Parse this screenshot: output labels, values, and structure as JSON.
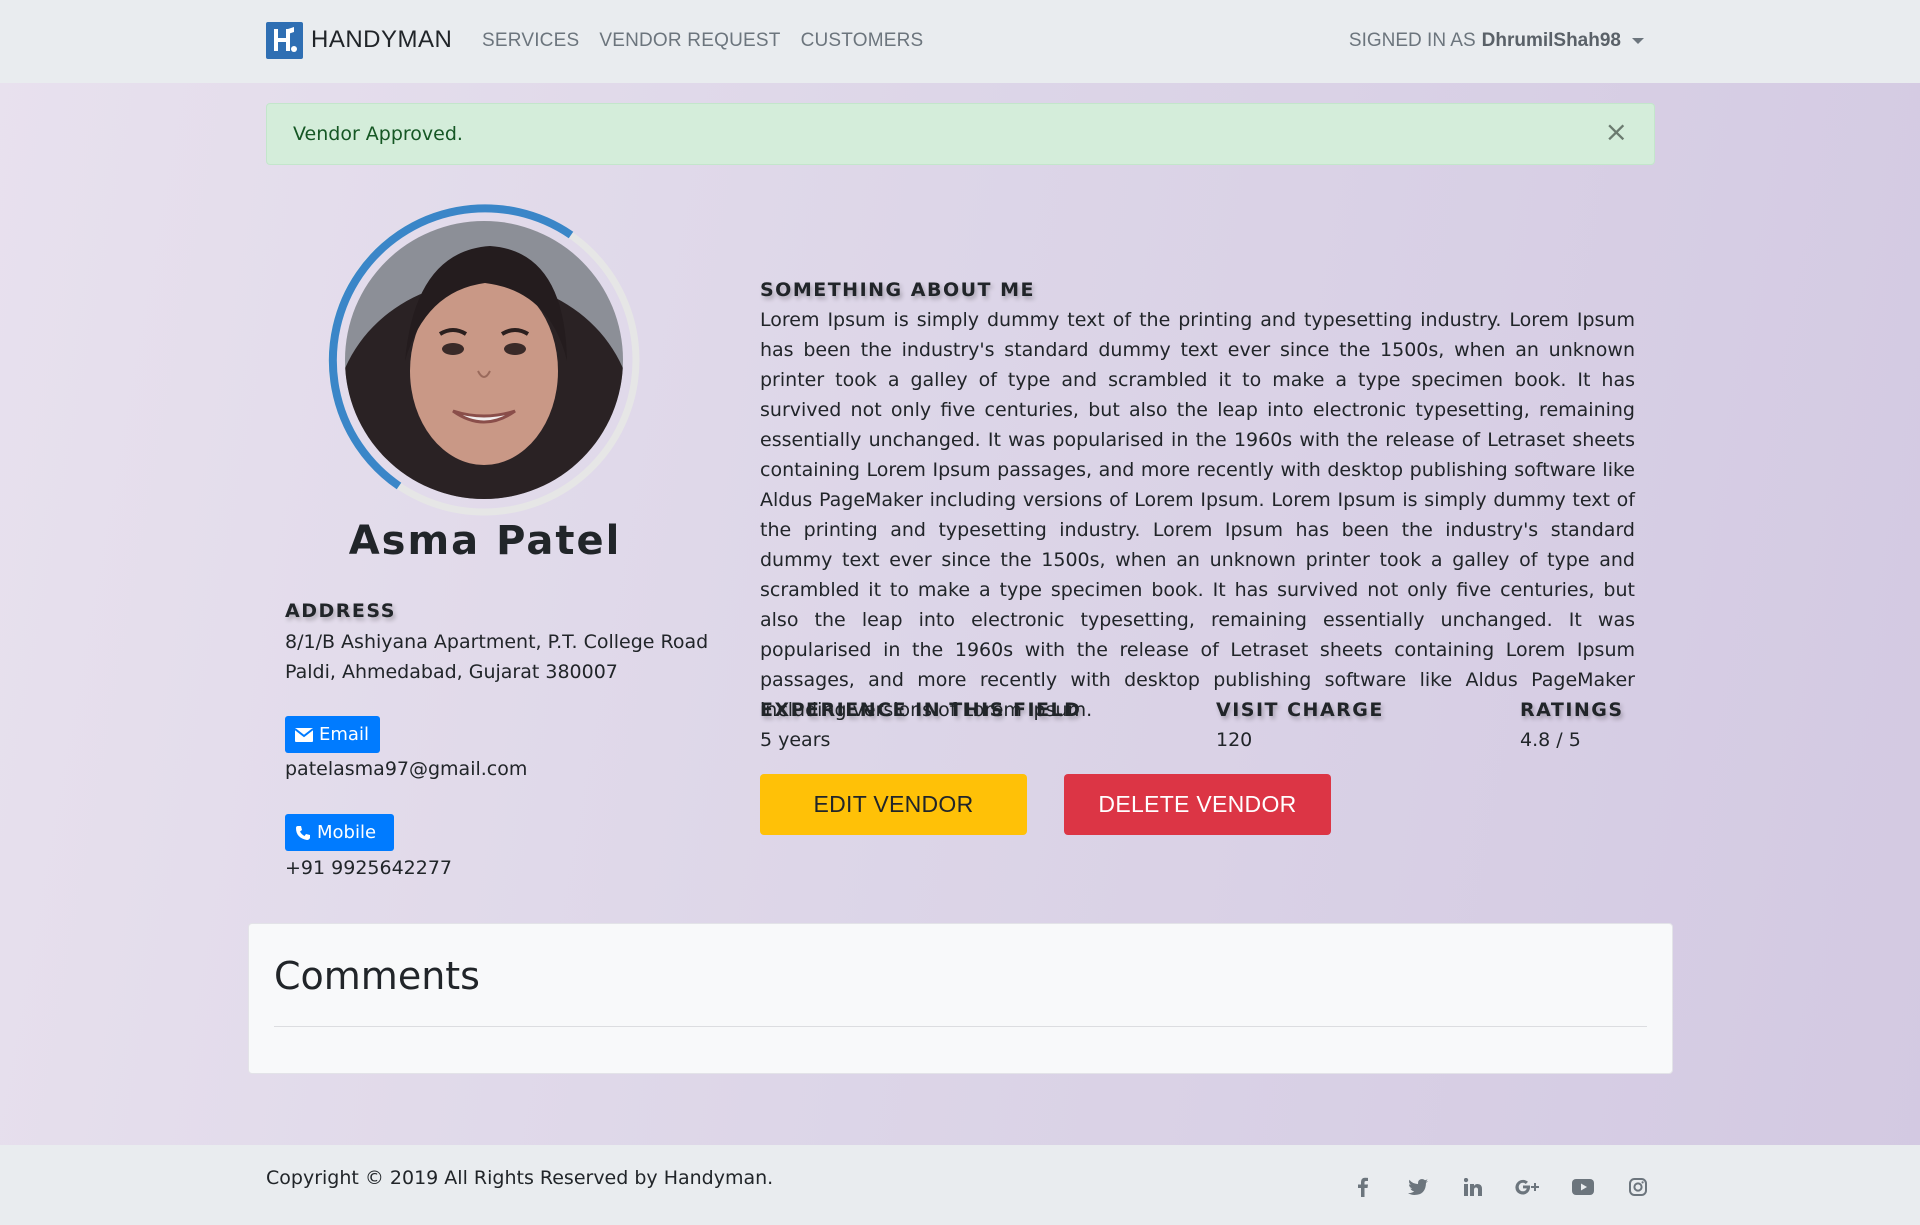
{
  "navbar": {
    "brand_name": "HANDYMAN",
    "links": [
      "SERVICES",
      "VENDOR REQUEST",
      "CUSTOMERS"
    ],
    "signed_in_prefix": "SIGNED IN AS",
    "username": "DhrumilShah98"
  },
  "alert": {
    "message": "Vendor Approved.",
    "close_symbol": "×"
  },
  "profile": {
    "name": "Asma Patel",
    "address_title": "ADDRESS",
    "address_line1": "8/1/B Ashiyana Apartment, P.T. College Road",
    "address_line2": "Paldi, Ahmedabad, Gujarat 380007",
    "email_label": "Email",
    "email": "patelasma97@gmail.com",
    "mobile_label": "Mobile",
    "mobile": "+91 9925642277"
  },
  "about": {
    "title": "SOMETHING ABOUT ME",
    "text": "Lorem Ipsum is simply dummy text of the printing and typesetting industry. Lorem Ipsum has been the industry's standard dummy text ever since the 1500s, when an unknown printer took a galley of type and scrambled it to make a type specimen book. It has survived not only five centuries, but also the leap into electronic typesetting, remaining essentially unchanged. It was popularised in the 1960s with the release of Letraset sheets containing Lorem Ipsum passages, and more recently with desktop publishing software like Aldus PageMaker including versions of Lorem Ipsum. Lorem Ipsum is simply dummy text of the printing and typesetting industry. Lorem Ipsum has been the industry's standard dummy text ever since the 1500s, when an unknown printer took a galley of type and scrambled it to make a type specimen book. It has survived not only five centuries, but also the leap into electronic typesetting, remaining essentially unchanged. It was popularised in the 1960s with the release of Letraset sheets containing Lorem Ipsum passages, and more recently with desktop publishing software like Aldus PageMaker including versions of Lorem Ipsum."
  },
  "stats": {
    "experience_title": "EXPERIENCE IN THIS FIELD",
    "experience_value": "5 years",
    "visit_title": "VISIT CHARGE",
    "visit_value": "120",
    "ratings_title": "RATINGS",
    "ratings_value": "4.8 / 5"
  },
  "actions": {
    "edit_label": "EDIT VENDOR",
    "delete_label": "DELETE VENDOR"
  },
  "comments": {
    "title": "Comments"
  },
  "footer": {
    "copyright": "Copyright © 2019 All Rights Reserved by Handyman.",
    "social_icons": [
      "facebook-icon",
      "twitter-icon",
      "linkedin-icon",
      "google-plus-icon",
      "youtube-icon",
      "instagram-icon"
    ]
  },
  "colors": {
    "primary": "#007bff",
    "warning": "#ffc107",
    "danger": "#dc3545",
    "alert_bg": "#d4edda",
    "alert_text": "#155724",
    "brand_blue": "#2f6fb3",
    "navbar_bg": "#e9ecef"
  }
}
